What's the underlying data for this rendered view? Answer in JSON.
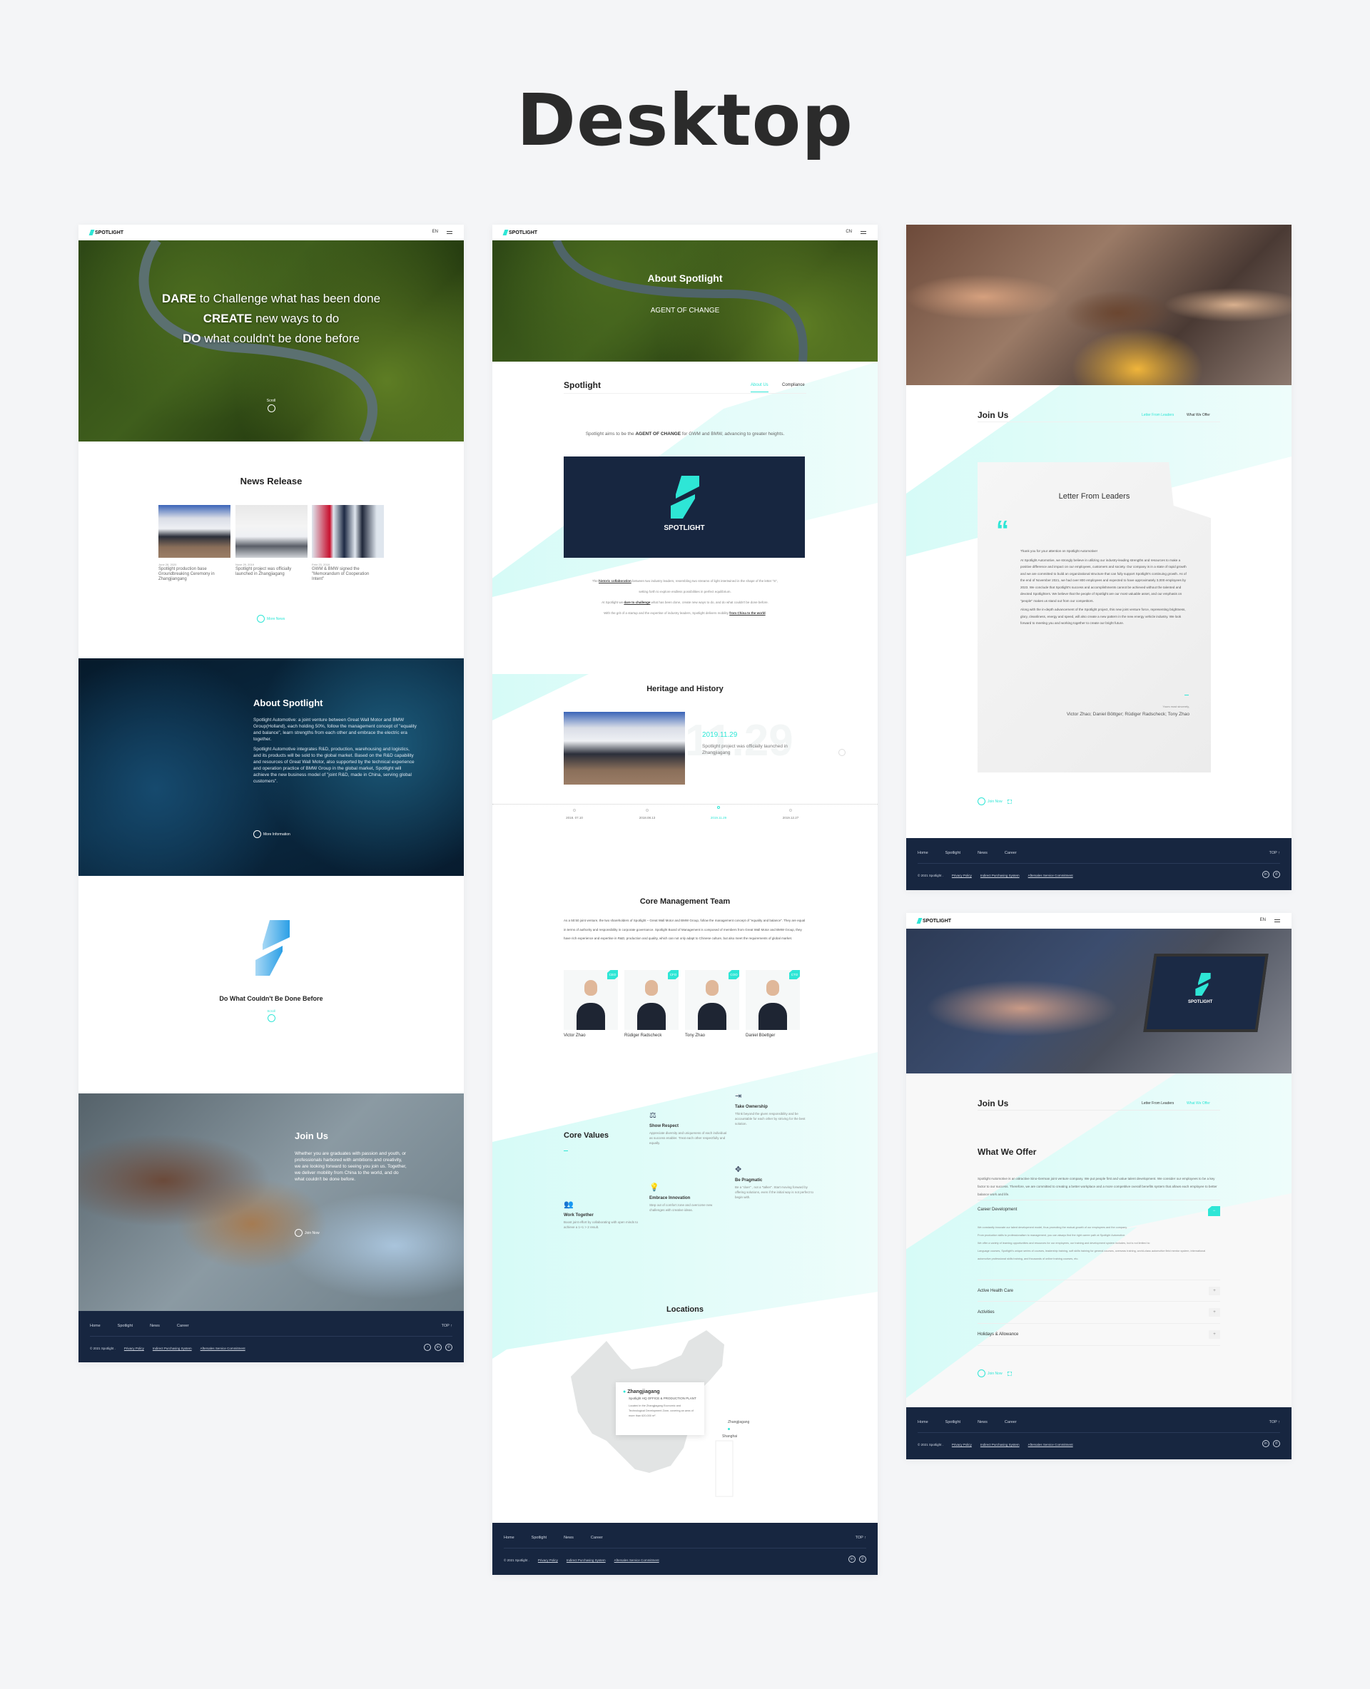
{
  "page_title": "Desktop",
  "brand": "SPOTLIGHT",
  "accent_color": "#2ee6d6",
  "footer_color": "#172640",
  "footer": {
    "nav": [
      "Home",
      "Spotlight",
      "News",
      "Career"
    ],
    "top": "TOP ↑",
    "copyright": "© 2021 Spotlight .",
    "legal": [
      "Privacy Policy",
      "Indirect Purchasing System",
      "Aftersales Service Commitment"
    ],
    "social_icons": [
      "wechat-icon",
      "linkedin-icon",
      "phone-icon"
    ]
  },
  "home": {
    "lang": "EN",
    "hero": {
      "line1_bold": "DARE",
      "line1_rest": " to Challenge what has been done",
      "line2_bold": "CREATE",
      "line2_rest": " new ways to do",
      "line3_bold": "DO",
      "line3_rest": " what couldn't be done before",
      "scroll": "Scroll"
    },
    "news": {
      "title": "News Release",
      "items": [
        {
          "date": "June 28, 2020",
          "title": "Spotlight production base Groundbreaking Ceremony in Zhangjiangang"
        },
        {
          "date": "Nove 29, 2019",
          "title": "Spotlight project was officially launched in Zhangjiagang"
        },
        {
          "date": "Febr 23, 2018",
          "title": "GWM & BMW signed the \"Memorandum of Cooperation Intent\""
        }
      ],
      "more": "More News"
    },
    "about": {
      "title": "About Spotlight",
      "p1": "Spotlight Automotive: a joint venture between Great Wall Motor and BMW Group(Holland), each holding 50%, follow the management concept of \"equality and balance\", learn strengths from each other and embrace the electric era together.",
      "p2": "Spotlight Automotive integrates R&D, production, warehousing and logistics, and its products will be sold to the global market. Based on the R&D capability and resources of Great Wall Motor, also supported by the technical experience and operation practice of BMW Group in the global market, Spotlight will achieve the new business model of \"joint R&D, made in China, serving global customers\".",
      "more": "More Information"
    },
    "slogan": {
      "title": "Do What Couldn't Be Done Before",
      "scroll": "Scroll"
    },
    "join": {
      "title": "Join Us",
      "text": "Whether you are graduates with passion and youth, or professionals harbored with ambitions and creativity, we are looking forward to seeing you join us. Together, we deliver mobility from China to the world, and do what couldn't be done before.",
      "button": "Join Now"
    }
  },
  "about_page": {
    "lang": "CN",
    "hero_title": "About Spotlight",
    "hero_sub": "AGENT OF CHANGE",
    "section_title": "Spotlight",
    "tabs": [
      "About Us",
      "Compliance"
    ],
    "active_tab": "About Us",
    "tagline_pre": "Spotlight aims to be the ",
    "tagline_bold": "AGENT OF CHANGE",
    "tagline_post": " for GWM and BMW, advancing to greater heights.",
    "logo_text": "SPOTLIGHT",
    "para": [
      {
        "pre": "The ",
        "bold": "historic collaboration",
        "post": " between two industry leaders, resembling two streams of light intertwined in the shape of the letter \"S\","
      },
      {
        "pre": "setting forth to explore endless possibilities in perfect equilibrium.",
        "bold": "",
        "post": ""
      },
      {
        "pre": "At Spotlight we ",
        "bold": "dare to challenge",
        "post": " what has been done, create new ways to do, and do what couldn't be done before."
      },
      {
        "pre": "With the grit of a startup and the expertise of industry leaders, Spotlight delivers mobility ",
        "bold": "from China to the world",
        "post": "."
      }
    ],
    "heritage": {
      "title": "Heritage and History",
      "date": "2019.11.29",
      "bg_date": "11.29",
      "text": "Spotlight project was officially launched in Zhangjiagang",
      "timeline": [
        "2018. 07.10",
        "2018.08.13",
        "2019.11.29",
        "2019.12.27"
      ],
      "active_index": 2
    },
    "team": {
      "title": "Core Management Team",
      "text": "As a 50:50 joint venture, the two shareholders of Spotlight – Great Wall Motor and BMW Group, follow the management concept of \"equality and balance\". They are equal in terms of authority and responsibility in corporate governance. Spotlight Board of Management is composed of members from Great Wall Motor and BMW Group, they have rich experience and expertise in R&D, production and quality, which can not only adapt to Chinese culture, but also meet the requirements of global market.",
      "members": [
        {
          "name": "Victor Zhao",
          "role": "CEO"
        },
        {
          "name": "Rüdiger  Radscheck",
          "role": "CFO"
        },
        {
          "name": "Tony Zhao",
          "role": "COO"
        },
        {
          "name": "Daniel Böettger",
          "role": "CTO"
        }
      ]
    },
    "values": {
      "title": "Core Values",
      "items": [
        {
          "title": "Take Ownership",
          "text": "Think beyond the given responsibility and be accountable for each other by striving for the best solution.",
          "icon": "exit-arrow-icon"
        },
        {
          "title": "Show Respect",
          "text": "Appreciate diversity and uniqueness of each individual as success enabler. Treat each other respectfully and equally.",
          "icon": "scale-icon"
        },
        {
          "title": "Be Pragmatic",
          "text": "Be a \"doer\" , not a \"talker\". Start moving forward by offering solutions, even if the initial way is not perfect to begin with.",
          "icon": "move-cross-icon"
        },
        {
          "title": "Embrace Innovation",
          "text": "Step out of comfort zone and overcome new challenges with creative ideas.",
          "icon": "lightbulb-icon"
        },
        {
          "title": "Work Together",
          "text": "Boost joint effort by collaborating with open minds to achieve a 1+1 > 2 result.",
          "icon": "people-icon"
        }
      ]
    },
    "locations": {
      "title": "Locations",
      "card_title": "Zhangjiagang",
      "card_sub": "Spotlight HQ OFFICE & PRODUCTION PLANT",
      "card_text": "Located in the Zhangjiagang Economic and Technological Development Zone, covering an area of more than 620,000 m².",
      "pins": [
        "Zhangjiagang",
        "Shanghai"
      ]
    }
  },
  "letter_page": {
    "title": "Join Us",
    "tabs": [
      "Letter From Leaders",
      "What We Offer"
    ],
    "active_tab": "Letter From Leaders",
    "letter_title": "Letter From Leaders",
    "greeting": "Thank you for your attention on Spotlight Automotive!",
    "p1": "At Spotlight Automotive, we strongly believe in utilizing our industry-leading strengths and resources to make a positive difference and impact on our employees, customers and society. Our company is in a state of rapid growth and we are committed to build an organizational structure that can fully support Spotlight's continuing growth. As of the end of November 2021, we had over 800 employees and expected to have approximately 3,000 employees by 2023. We conclude that Spotlight's success and accomplishments cannot be achieved without the talented and devoted Spotlighters. We believe that the people of Spotlight are our most valuable asset, and our emphasis on \"people\" makes us stand out from our competitors.",
    "p2": "Along with the in-depth advancement of the Spotlight project, this new joint venture force, representing brightness, glory, cleanliness, energy and speed, will also create a new pattern in the new energy vehicle industry.  We look forward to meeting you and working together to create our bright future.",
    "closing": "Yours most sincerely,",
    "signature": "Victor Zhao; Daniel Böttger; Rüdiger Radscheck; Tony Zhao",
    "button": "Join Now"
  },
  "offer_page": {
    "lang": "EN",
    "laptop_logo": "SPOTLIGHT",
    "title": "Join Us",
    "tabs": [
      "Letter From Leaders",
      "What We Offer"
    ],
    "active_tab": "What We Offer",
    "heading": "What We Offer",
    "intro": "Spotlight Automotive is an attractive Sino-German joint venture company. We put people first and value talent development. We consider our employees to be a key factor to our success. Therefore, we are committed to creating a better workplace and a more competitive overall benefits system that allows each employee to better balance work and life.",
    "sections": [
      {
        "title": "Career Development",
        "expanded": true,
        "lines": [
          "We constantly innovate our talent development model, thus promoting the mutual growth of our employees and the company.",
          "From production skills to professionalism to management, you can always find the right career path at Spotlight Automotive.",
          "We offer a variety of learning opportunities and resources for our employees, our training and development system includes, but is not limited to:",
          "Language courses, Spotlight's unique series of courses, leadership training, soft skills training for general courses, overseas training, world-class automotive field mentor system, international automotive professional skills training, and thousands of online training courses, etc."
        ]
      },
      {
        "title": "Active Health Care",
        "expanded": false
      },
      {
        "title": "Activities",
        "expanded": false
      },
      {
        "title": "Holidays & Allowance",
        "expanded": false
      }
    ],
    "button": "Join Now"
  }
}
